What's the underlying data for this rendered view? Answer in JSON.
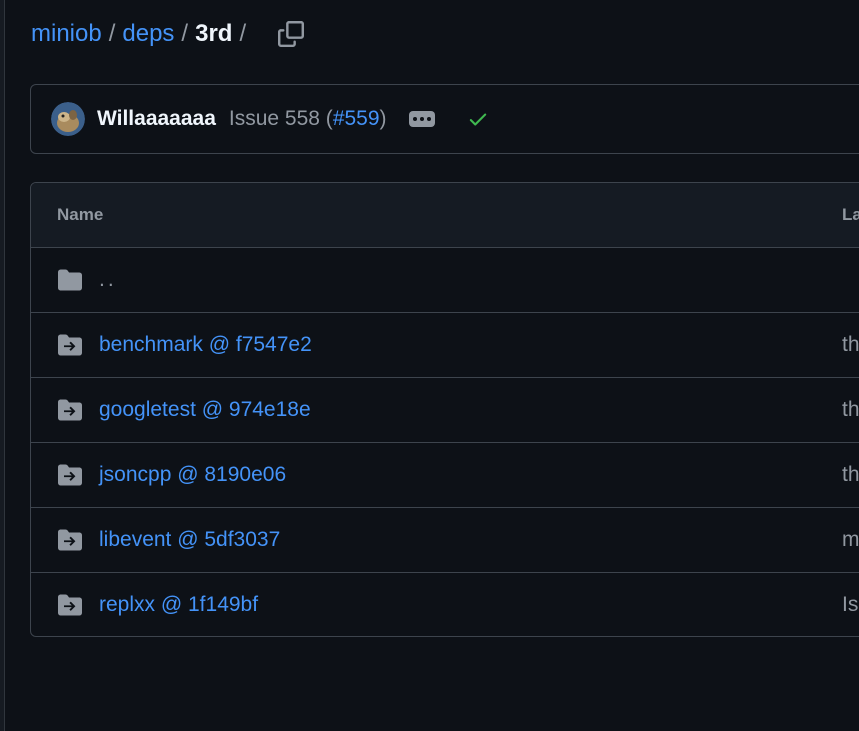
{
  "breadcrumb": {
    "repo": "miniob",
    "parent": "deps",
    "current": "3rd",
    "separator": "/"
  },
  "commit": {
    "author": "Willaaaaaaa",
    "message_prefix": "Issue 558 (",
    "pr_number": "#559",
    "message_suffix": ")",
    "status": "success"
  },
  "table": {
    "headers": {
      "name": "Name",
      "last_commit": "La"
    },
    "parent_row": {
      "label": ".."
    },
    "rows": [
      {
        "name": "benchmark @ f7547e2",
        "message": "th"
      },
      {
        "name": "googletest @ 974e18e",
        "message": "th"
      },
      {
        "name": "jsoncpp @ 8190e06",
        "message": "th"
      },
      {
        "name": "libevent @ 5df3037",
        "message": "m"
      },
      {
        "name": "replxx @ 1f149bf",
        "message": "Is"
      }
    ]
  },
  "colors": {
    "background": "#0d1117",
    "link": "#4493f8",
    "muted": "#9198a1",
    "border": "#3d444d",
    "success": "#3fb950"
  },
  "icons": {
    "copy": "copy-icon",
    "ellipsis": "kebab-horizontal-icon",
    "check": "check-icon",
    "folder": "folder-icon",
    "submodule": "file-submodule-icon"
  }
}
